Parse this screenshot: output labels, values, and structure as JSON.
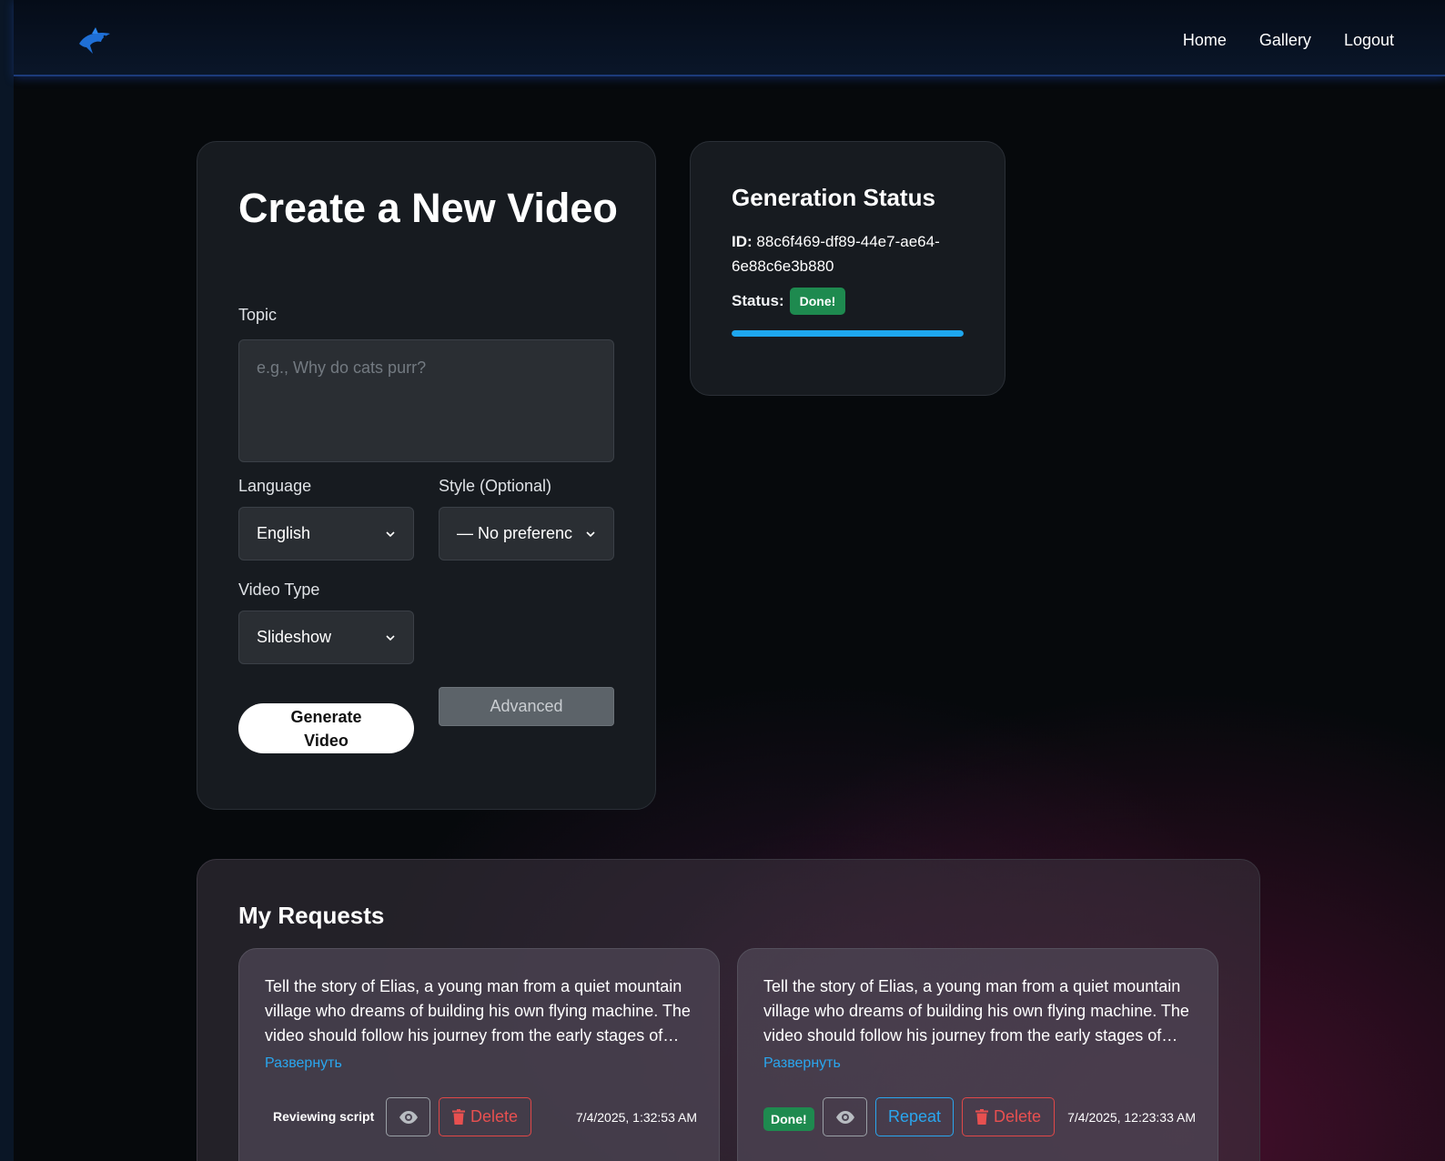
{
  "nav": {
    "logo_icon": "shark-logo-icon",
    "links": [
      "Home",
      "Gallery",
      "Logout"
    ]
  },
  "create": {
    "title": "Create a New Video",
    "topic_label": "Topic",
    "topic_placeholder": "e.g., Why do cats purr?",
    "language_label": "Language",
    "language_value": "English",
    "style_label": "Style (Optional)",
    "style_value": "— No preferenc",
    "video_type_label": "Video Type",
    "video_type_value": "Slideshow",
    "generate_label": "Generate Video",
    "advanced_label": "Advanced"
  },
  "status": {
    "title": "Generation Status",
    "id_label": "ID:",
    "id_value": "88c6f469-df89-44e7-ae64-6e88c6e3b880",
    "status_label": "Status:",
    "status_value": "Done!",
    "progress_percent": 100,
    "progress_color": "#1ea7ee"
  },
  "requests": {
    "title": "My Requests",
    "expand_label": "Развернуть",
    "delete_label": "Delete",
    "repeat_label": "Repeat",
    "items": [
      {
        "text": "Tell the story of Elias, a young man from a quiet mountain village who dreams of building his own flying machine. The video should follow his journey from the early stages of…",
        "status": "Reviewing script",
        "date": "7/4/2025, 1:32:53 AM"
      },
      {
        "text": "Tell the story of Elias, a young man from a quiet mountain village who dreams of building his own flying machine. The video should follow his journey from the early stages of…",
        "status": "Done!",
        "date": "7/4/2025, 12:23:33 AM"
      }
    ]
  },
  "colors": {
    "accent": "#1ea7ee",
    "success": "#1e8a4f",
    "danger": "#e04848"
  }
}
